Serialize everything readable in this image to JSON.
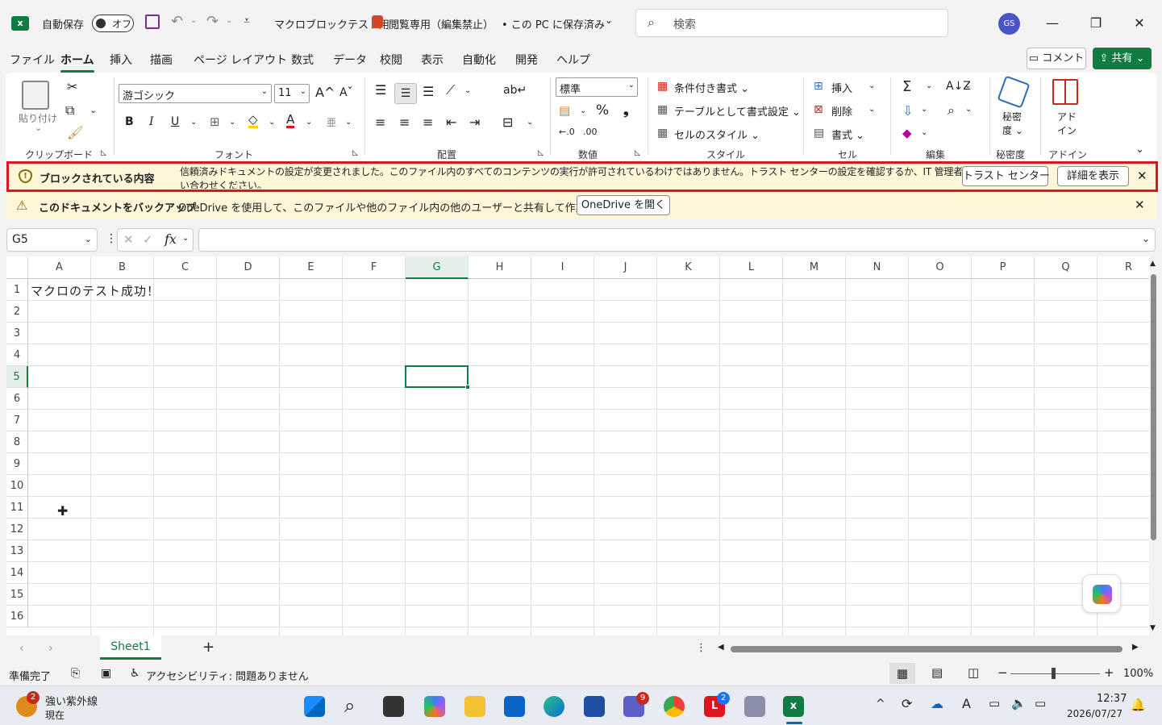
{
  "titlebar": {
    "app_icon": "excel-icon",
    "autosave_label": "自動保存",
    "autosave_state": "オフ",
    "filename": "マクロブロックテスト用",
    "mode": "閲覧専用（編集禁止）",
    "save_state": "• この PC に保存済み",
    "search_placeholder": "検索",
    "avatar_initials": "GS"
  },
  "menu": {
    "tabs": [
      "ファイル",
      "ホーム",
      "挿入",
      "描画",
      "ページ レイアウト",
      "数式",
      "データ",
      "校閲",
      "表示",
      "自動化",
      "開発",
      "ヘルプ"
    ],
    "active_tab": "ホーム",
    "comment_label": "コメント",
    "share_label": "共有"
  },
  "ribbon": {
    "clipboard": {
      "paste_label": "貼り付け",
      "group": "クリップボード"
    },
    "font": {
      "font_name": "游ゴシック",
      "font_size": "11",
      "group": "フォント"
    },
    "alignment": {
      "group": "配置"
    },
    "number": {
      "format": "標準",
      "group": "数値"
    },
    "styles": {
      "conditional": "条件付き書式",
      "table": "テーブルとして書式設定",
      "cell_styles": "セルのスタイル",
      "group": "スタイル"
    },
    "cells": {
      "insert": "挿入",
      "delete": "削除",
      "format": "書式",
      "group": "セル"
    },
    "editing": {
      "group": "編集"
    },
    "sensitivity": {
      "label1": "秘密",
      "label2": "度",
      "group": "秘密度"
    },
    "addins": {
      "label1": "アド",
      "label2": "イン",
      "group": "アドイン"
    }
  },
  "message_bars": {
    "blocked": {
      "title": "ブロックされている内容",
      "text_line1": "信頼済みドキュメントの設定が変更されました。このファイル内のすべてのコンテンツの実行が許可されているわけではありません。トラスト センターの設定を確認するか、IT 管理者にお問",
      "text_line2": "い合わせください。",
      "button1": "トラスト センター",
      "button2": "詳細を表示"
    },
    "backup": {
      "title": "このドキュメントをバックアップ",
      "text": "OneDrive を使用して、このファイルや他のファイル内の他のユーザーと共有して作業します。",
      "button": "OneDrive を開く"
    }
  },
  "formula_bar": {
    "name_box": "G5",
    "formula": ""
  },
  "grid": {
    "columns": [
      "A",
      "B",
      "C",
      "D",
      "E",
      "F",
      "G",
      "H",
      "I",
      "J",
      "K",
      "L",
      "M",
      "N",
      "O",
      "P",
      "Q",
      "R"
    ],
    "rows": [
      "1",
      "2",
      "3",
      "4",
      "5",
      "6",
      "7",
      "8",
      "9",
      "10",
      "11",
      "12",
      "13",
      "14",
      "15",
      "16"
    ],
    "cell_A1": "マクロのテスト成功！",
    "selected_cell": "G5"
  },
  "sheets": {
    "tabs": [
      "Sheet1"
    ],
    "active": "Sheet1"
  },
  "status": {
    "ready": "準備完了",
    "accessibility": "アクセシビリティ: 問題ありません",
    "zoom": "100%"
  },
  "taskbar": {
    "weather_title": "強い紫外線",
    "weather_sub": "現在",
    "weather_badge": "2",
    "teams_badge": "9",
    "l_badge": "2",
    "time": "12:37",
    "date": "2026/07/27"
  },
  "colors": {
    "excel_green": "#107c41",
    "message_bg": "#fdf6d8",
    "highlight_red": "#e0141e"
  }
}
